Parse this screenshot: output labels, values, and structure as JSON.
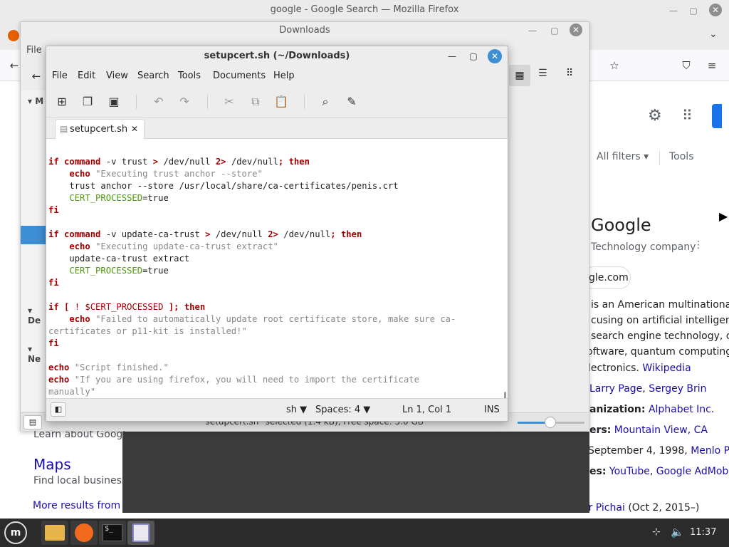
{
  "firefox": {
    "window_title": "google - Google Search — Mozilla Firefox",
    "menu_file": "File",
    "google": {
      "all_filters": "All filters",
      "tools": "Tools",
      "kp_title": "Google",
      "kp_subtitle": "Technology company",
      "kp_site": "gle.com",
      "kp_desc": [
        "is an American multinational",
        "cusing on artificial intelligence",
        "search engine technology, clo",
        "oftware, quantum computing, e"
      ],
      "kp_desc_last": "lectronics.",
      "kp_wiki": "Wikipedia",
      "founders": {
        "a": "Larry Page",
        "sep": ", ",
        "b": "Sergey Brin"
      },
      "org_label": "anization:",
      "org_value": "Alphabet Inc.",
      "hq_label": "ers:",
      "hq_value": "Mountain View, CA",
      "founded": "September 4, 1998,",
      "founded_link": "Menlo Par",
      "subs_label": "es:",
      "subs_a": "YouTube",
      "subs_sep": ", ",
      "subs_b": "Google AdMob",
      "ceo_a": "ar Pichai",
      "ceo_b": "(Oct 2, 2015–)",
      "learn_about": "Learn about Google",
      "maps_title": "Maps",
      "maps_desc": "Find local businesse",
      "more_results": "More results from go"
    }
  },
  "nemo": {
    "title": "Downloads",
    "status": "\"setupcert.sh\" selected (1.4 kB), Free space: 5.0 GB",
    "sidebar_initials": [
      "M",
      "De",
      "Ne"
    ]
  },
  "gedit": {
    "title": "setupcert.sh (~/Downloads)",
    "menu": [
      "File",
      "Edit",
      "View",
      "Search",
      "Tools",
      "Documents",
      "Help"
    ],
    "tab_label": "setupcert.sh",
    "status": {
      "language": "sh",
      "spaces": "Spaces: 4",
      "position": "Ln 1, Col 1",
      "mode": "INS"
    },
    "code": {
      "l1_if": "if",
      "l1_cmd": "command",
      "l1_rest": " -v trust ",
      "l1_gt": ">",
      "l1_null": " /dev/null ",
      "l1_2gt": "2>",
      "l1_null2": " /dev/null",
      "l1_then": "; then",
      "l2_echo": "echo",
      "l2_str": "\"Executing trust anchor --store\"",
      "l3": "trust anchor --store /usr/local/share/ca-certificates/penis.crt",
      "l4_var": "CERT_PROCESSED",
      "l4_val": "=true",
      "fi": "fi",
      "l6_rest": " -v update-ca-trust ",
      "l7_str": "\"Executing update-ca-trust extract\"",
      "l8": "update-ca-trust extract",
      "l11_a": "if",
      "l11_b": " [ ",
      "l11_bang": "!",
      "l11_var": " $CERT_PROCESSED ",
      "l11_c": "];",
      "l11_then": " then",
      "l12_str": "\"Failed to automatically update root certificate store, make sure ca-",
      "l13_str": "certificates or p11-kit is installed!\"",
      "l15_str": "\"Script finished.\"",
      "l16_str": "\"If you are using firefox, you will need to import the certificate",
      "l17_str": "manually\""
    }
  },
  "taskbar": {
    "clock": "11:37"
  },
  "colors": {
    "keyword": "#a40000",
    "string": "#8a8a8a",
    "variable": "#4e9a06",
    "link": "#1a0dab",
    "close_active": "#3d8fd6"
  }
}
